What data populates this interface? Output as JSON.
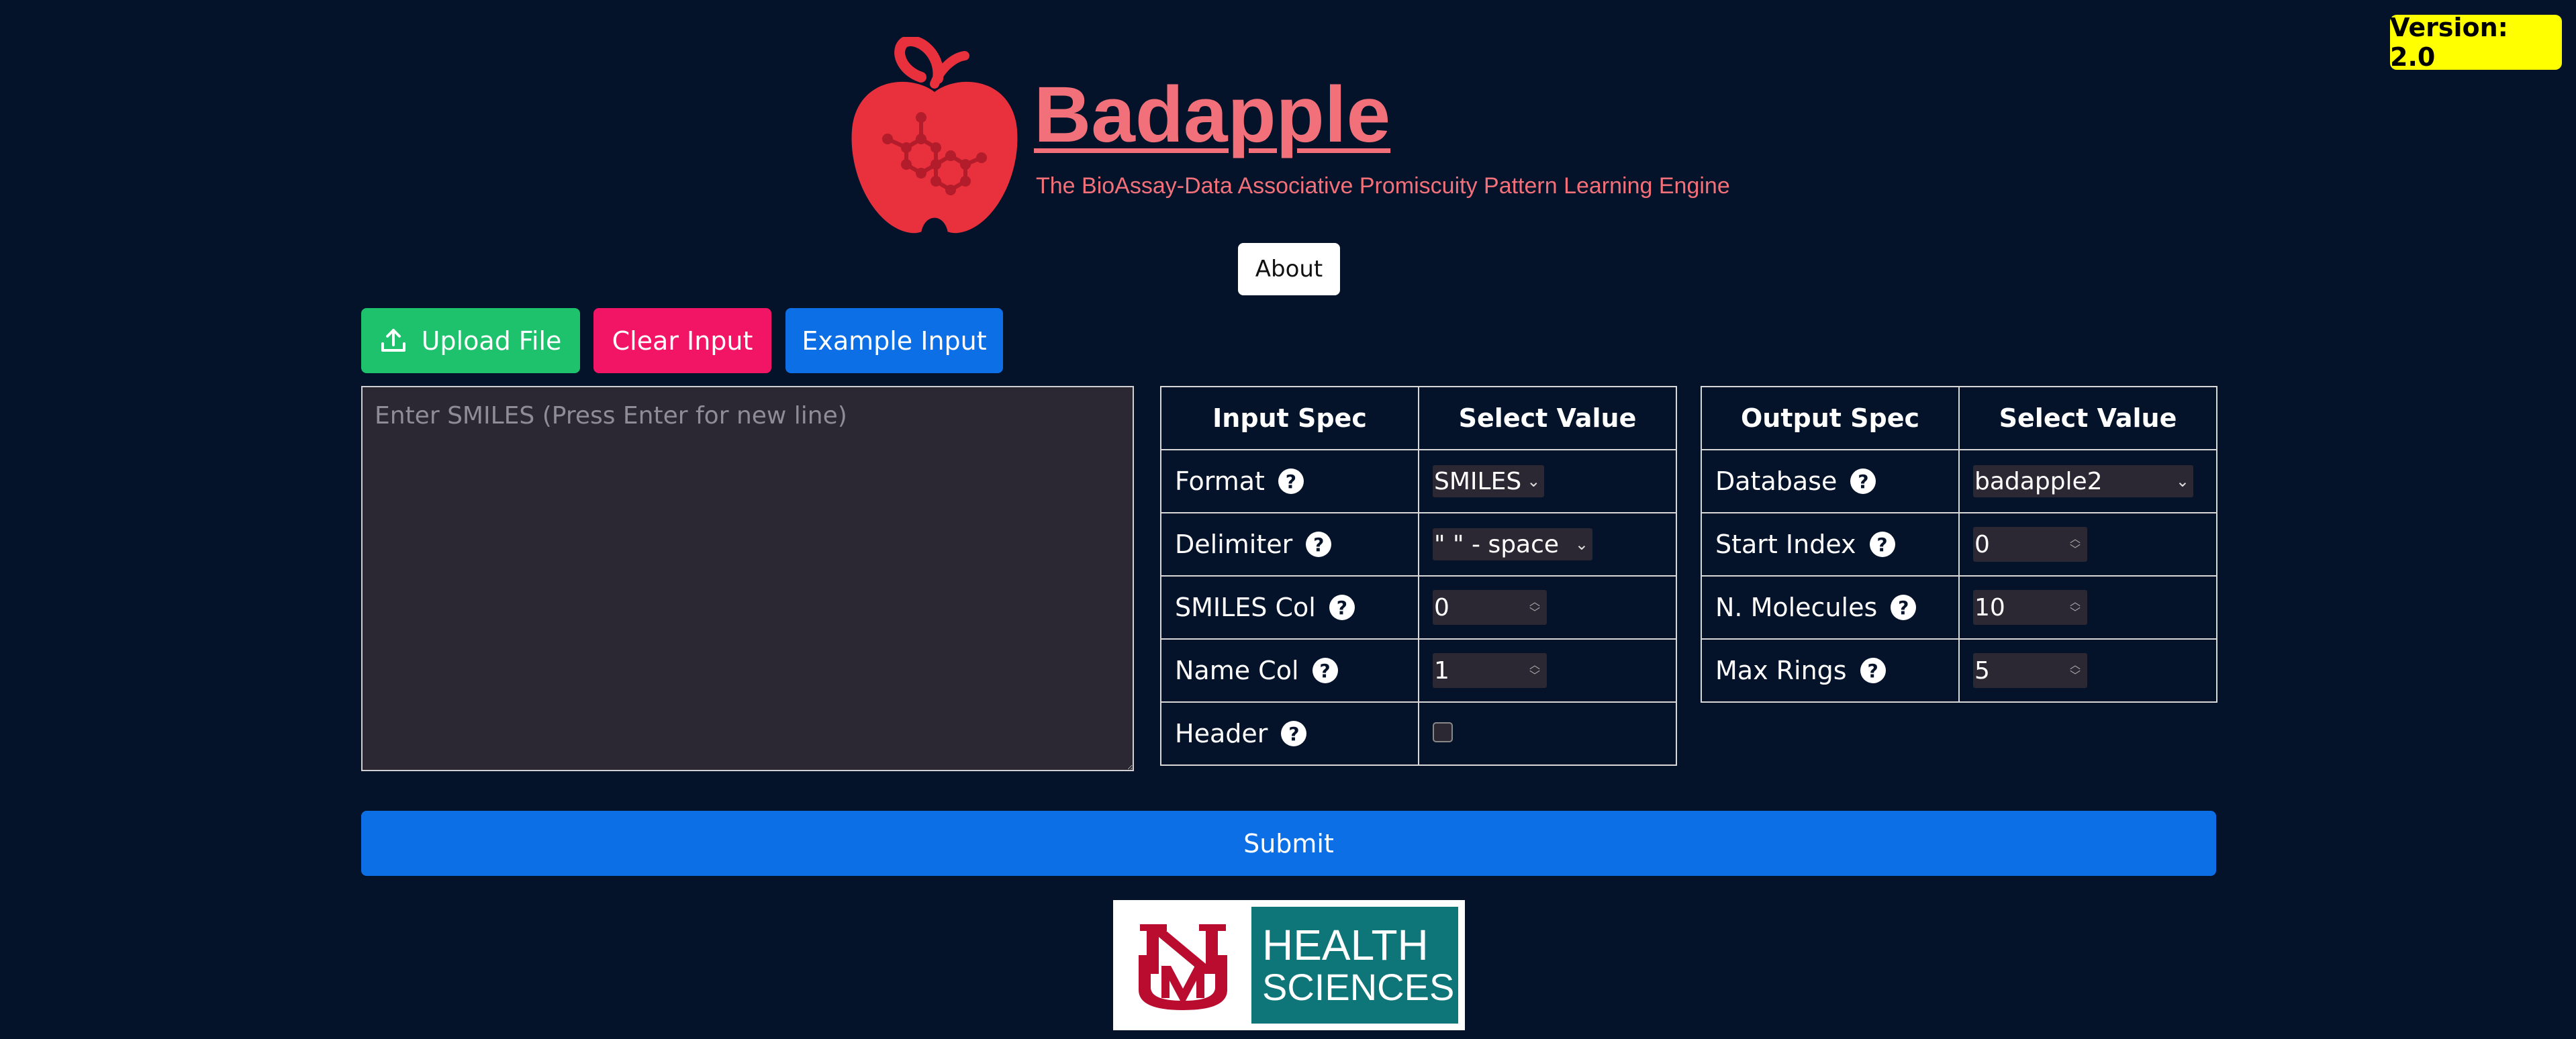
{
  "version": {
    "label": "Version: 2.0"
  },
  "header": {
    "title": "Badapple",
    "subtitle": "The BioAssay-Data Associative Promiscuity Pattern Learning Engine",
    "about_label": "About"
  },
  "actions": {
    "upload_label": "Upload File",
    "clear_label": "Clear Input",
    "example_label": "Example Input"
  },
  "smiles_input": {
    "placeholder": "Enter SMILES (Press Enter for new line)",
    "value": ""
  },
  "input_spec": {
    "header_spec": "Input Spec",
    "header_value": "Select Value",
    "rows": [
      {
        "label": "Format",
        "value": "SMILES"
      },
      {
        "label": "Delimiter",
        "value": "\" \" - space"
      },
      {
        "label": "SMILES Col",
        "value": "0"
      },
      {
        "label": "Name Col",
        "value": "1"
      },
      {
        "label": "Header",
        "checked": false
      }
    ]
  },
  "output_spec": {
    "header_spec": "Output Spec",
    "header_value": "Select Value",
    "rows": [
      {
        "label": "Database",
        "value": "badapple2"
      },
      {
        "label": "Start Index",
        "value": "0"
      },
      {
        "label": "N. Molecules",
        "value": "10"
      },
      {
        "label": "Max Rings",
        "value": "5"
      }
    ]
  },
  "help_icon_glyph": "?",
  "submit_label": "Submit",
  "footer_logo": {
    "line1": "HEALTH",
    "line2": "SCIENCES",
    "monogram": "UNM"
  },
  "colors": {
    "background": "#04132a",
    "brand": "#f27079",
    "upload": "#1ec16c",
    "clear": "#f21565",
    "primary": "#0d6fe6",
    "version": "#ffff00",
    "unm_teal": "#0e7679",
    "unm_red": "#ba0c2f"
  },
  "icons": {
    "upload": "upload-icon",
    "help": "help-icon",
    "logo": "apple-molecule-logo"
  }
}
